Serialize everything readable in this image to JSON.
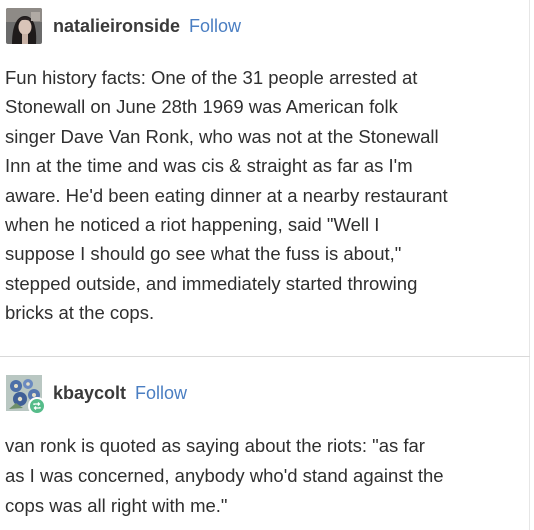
{
  "posts": [
    {
      "username": "natalieironside",
      "follow_label": "Follow",
      "avatar_icon": "profile-photo-avatar",
      "lines": [
        "Fun history facts:  One of the 31 people arrested at",
        "Stonewall on June 28th 1969 was American folk",
        "singer Dave Van Ronk, who was not at the Stonewall",
        "Inn at the time and was cis & straight as far as I'm",
        "aware. He'd been eating dinner at a nearby restaurant",
        "when he noticed a riot happening, said \"Well I",
        "suppose I should go see what the fuss is about,\"",
        "stepped outside, and immediately started throwing",
        "bricks at the cops."
      ]
    },
    {
      "username": "kbaycolt",
      "follow_label": "Follow",
      "avatar_icon": "flower-avatar",
      "badge_icon": "reblog-icon",
      "lines": [
        "van ronk is quoted as saying about the riots: \"as far",
        "as I was concerned, anybody who'd stand against the",
        "cops was all right with me.\""
      ]
    }
  ],
  "colors": {
    "follow_link": "#4a7ec2",
    "badge_green": "#56bc8a",
    "text": "#2f2f2f"
  }
}
